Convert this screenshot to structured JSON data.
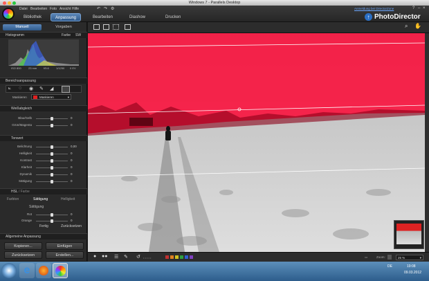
{
  "window": {
    "title": "Windows 7 - Parallels Desktop"
  },
  "app": {
    "menu": [
      "Datei",
      "Bearbeiten",
      "Foto",
      "Ansicht",
      "Hilfe"
    ],
    "mode_tabs": [
      "Bibliothek",
      "Anpassung",
      "Bearbeiten",
      "Diashow",
      "Drucken"
    ],
    "active_mode": "Anpassung",
    "signin_link": "Anmeldung bei DirectorZone",
    "brand": "PhotoDirector",
    "help": "?"
  },
  "left_panel": {
    "tabs": [
      "Manuell",
      "Vorgaben"
    ],
    "histogram": {
      "title": "Histogramm",
      "toggle": [
        "Farbe",
        "SW"
      ],
      "exif": [
        "ISO 800",
        "23 mm",
        "f/5.6",
        "1/1250",
        "0 EV"
      ]
    },
    "regional": {
      "title": "Bereichsanpassung",
      "mask_label": "Maskieren",
      "mask_value": "Maskieren"
    },
    "white_balance": {
      "title": "Weißabgleich",
      "rows": [
        {
          "label": "Blau/Gelb",
          "value": "0",
          "pos": 0.5
        },
        {
          "label": "Grün/Magenta",
          "value": "0",
          "pos": 0.5
        }
      ]
    },
    "tone": {
      "title": "Tonwert",
      "rows": [
        {
          "label": "Belichtung",
          "value": "0,00",
          "pos": 0.5
        },
        {
          "label": "Helligkeit",
          "value": "0",
          "pos": 0.5
        },
        {
          "label": "Kontrast",
          "value": "0",
          "pos": 0.5
        },
        {
          "label": "Klarheit",
          "value": "0",
          "pos": 0.5
        },
        {
          "label": "Dynamik",
          "value": "0",
          "pos": 0.5
        },
        {
          "label": "Sättigung",
          "value": "0",
          "pos": 0.5
        }
      ]
    },
    "hsl": {
      "title": "HSL",
      "title_suffix": "/ Farbe",
      "tabs": [
        "Farbton",
        "Sättigung",
        "Helligkeit"
      ],
      "sub_title": "Sättigung",
      "rows": [
        {
          "label": "Rot",
          "value": "0",
          "pos": 0.5
        },
        {
          "label": "Orange",
          "value": "0",
          "pos": 0.5
        }
      ],
      "buttons": [
        "Fertig",
        "Zurücksetzen"
      ]
    },
    "general": {
      "title": "Allgemeine Anpassung"
    },
    "footer_buttons": [
      "Kopieren...",
      "Einfügen",
      "Zurücksetzen",
      "Erstellen..."
    ]
  },
  "bottom_bar": {
    "zoom_label": "Zoom:",
    "zoom_value": "25 %",
    "swatch_colors": [
      "#c03030",
      "#e08020",
      "#d0c020",
      "#30a040",
      "#3060d0",
      "#8040c0"
    ]
  },
  "mask": {
    "color": "#ff0030",
    "opacity": 0.82
  },
  "taskbar": {
    "time": "19:08",
    "date": "09.03.2012",
    "lang": "DE"
  }
}
